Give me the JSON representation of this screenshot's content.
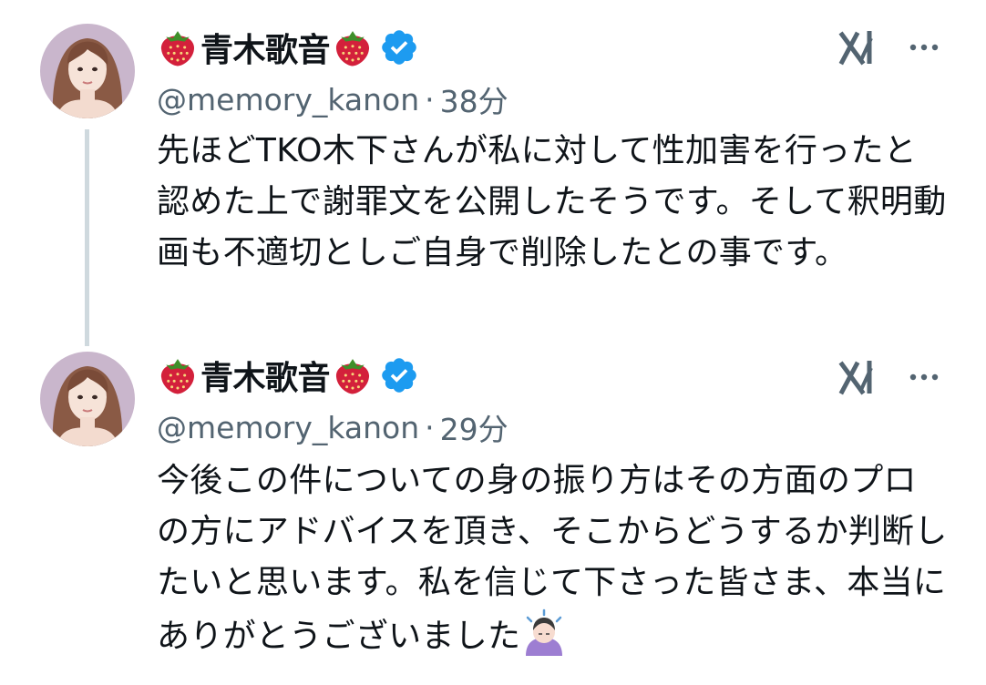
{
  "thread": {
    "tweets": [
      {
        "author": {
          "display_name": "青木歌音",
          "name_emoji": "strawberry-icon",
          "verified": true,
          "handle": "@memory_kanon"
        },
        "separator": "·",
        "time_ago": "38分",
        "text": "先ほどTKO木下さんが私に対して性加害を行ったと認めた上で謝罪文を公開したそうです。そして釈明動画も不適切としご自身で削除したとの事です。",
        "icons": [
          "grok-icon",
          "more-icon"
        ]
      },
      {
        "author": {
          "display_name": "青木歌音",
          "name_emoji": "strawberry-icon",
          "verified": true,
          "handle": "@memory_kanon"
        },
        "separator": "·",
        "time_ago": "29分",
        "text": "今後この件についての身の振り方はその方面のプロの方にアドバイスを頂き、そこからどうするか判断したいと思います。私を信じて下さった皆さま、本当にありがとうございました",
        "trailing_emoji": "person-bowing-icon",
        "icons": [
          "grok-icon",
          "more-icon"
        ]
      }
    ]
  },
  "colors": {
    "text": "#0f1419",
    "secondary": "#536471",
    "verified": "#1d9bf0",
    "thread_line": "#cfd9de",
    "strawberry": "#d3203b"
  }
}
